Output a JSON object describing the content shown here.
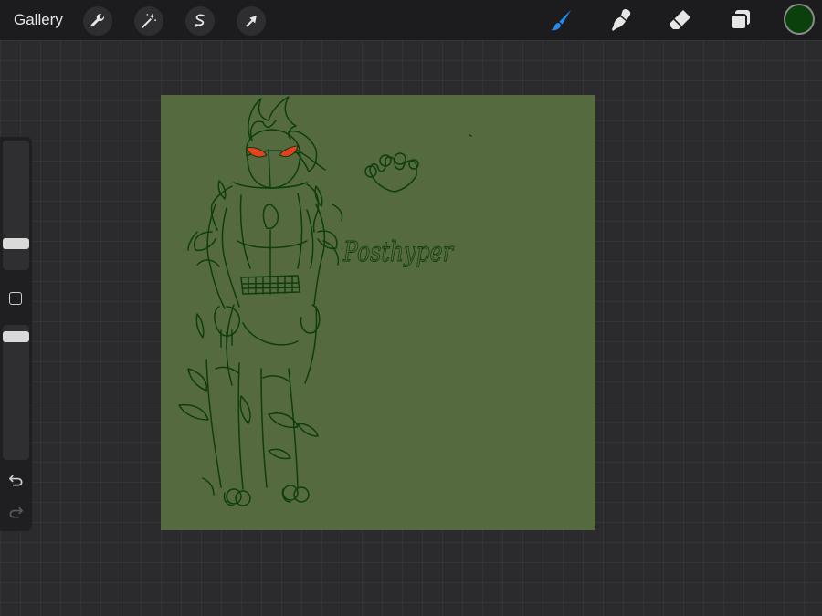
{
  "topbar": {
    "gallery_label": "Gallery",
    "left_tools": [
      "wrench-icon",
      "magic-wand-icon",
      "selection-icon",
      "transform-arrow-icon"
    ],
    "right_tools": [
      "brush-icon",
      "smudge-icon",
      "eraser-icon",
      "layers-icon"
    ],
    "active_tool": "brush",
    "active_color": "#0b3f0b"
  },
  "colors": {
    "accent": "#1e8cf0",
    "canvas_background": "#556b3f",
    "sketch_stroke": "#0e3d0e",
    "eye_fill": "#e83f1e"
  },
  "canvas": {
    "handwritten_text": "Posthyper"
  },
  "sidebar": {
    "brush_size_fraction": 0.18,
    "opacity_fraction": 0.95,
    "modify_button": "modify-square-icon",
    "undo": "undo-icon",
    "redo": "redo-icon"
  }
}
